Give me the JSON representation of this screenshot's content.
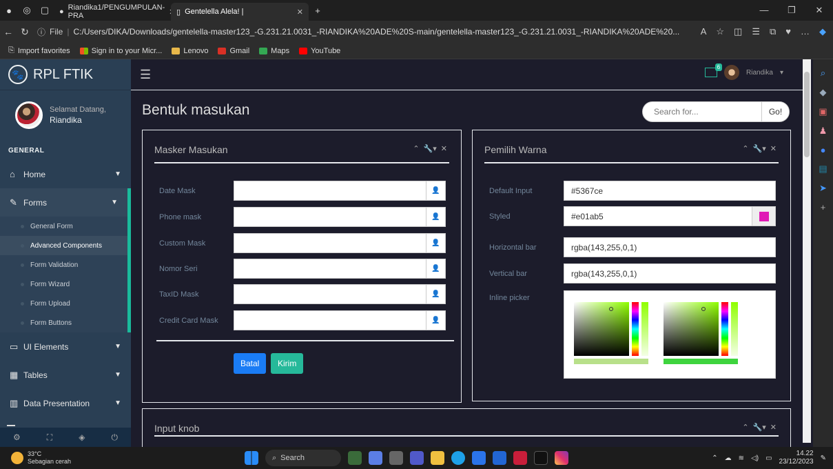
{
  "browser": {
    "tabs": [
      {
        "label": "Riandika1/PENGUMPULAN-PRA",
        "active": false
      },
      {
        "label": "Gentelella Alela! |",
        "active": true
      }
    ],
    "url_prefix": "File",
    "url": "C:/Users/DIKA/Downloads/gentelella-master123_-G.231.21.0031_-RIANDIKA%20ADE%20S-main/gentelella-master123_-G.231.21.0031_-RIANDIKA%20ADE%20...",
    "favorites": [
      "Import favorites",
      "Sign in to your Micr...",
      "Lenovo",
      "Gmail",
      "Maps",
      "YouTube"
    ]
  },
  "sidebar": {
    "brand": "RPL FTIK",
    "welcome": "Selamat Datang,",
    "username": "Riandika",
    "section": "GENERAL",
    "items": [
      {
        "label": "Home"
      },
      {
        "label": "Forms"
      },
      {
        "label": "UI Elements"
      },
      {
        "label": "Tables"
      },
      {
        "label": "Data Presentation"
      }
    ],
    "forms_sub": [
      {
        "label": "General Form"
      },
      {
        "label": "Advanced Components"
      },
      {
        "label": "Form Validation"
      },
      {
        "label": "Form Wizard"
      },
      {
        "label": "Form Upload"
      },
      {
        "label": "Form Buttons"
      }
    ]
  },
  "topnav": {
    "mail_count": "6",
    "user": "Riandika"
  },
  "page": {
    "title": "Bentuk masukan",
    "search_placeholder": "Search for...",
    "search_button": "Go!"
  },
  "mask_panel": {
    "title": "Masker Masukan",
    "fields": [
      {
        "label": "Date Mask"
      },
      {
        "label": "Phone mask"
      },
      {
        "label": "Custom Mask"
      },
      {
        "label": "Nomor Seri"
      },
      {
        "label": "TaxID Mask"
      },
      {
        "label": "Credit Card Mask"
      }
    ],
    "cancel": "Batal",
    "submit": "Kirim"
  },
  "color_panel": {
    "title": "Pemilih Warna",
    "default_label": "Default Input",
    "default_value": "#5367ce",
    "styled_label": "Styled",
    "styled_value": "#e01ab5",
    "styled_color": "#e01ab5",
    "hbar_label": "Horizontal bar",
    "hbar_value": "rgba(143,255,0,1)",
    "vbar_label": "Vertical bar",
    "vbar_value": "rgba(143,255,0,1)",
    "inline_label": "Inline picker"
  },
  "knob_panel": {
    "title": "Input knob"
  },
  "taskbar": {
    "temp": "33°C",
    "weather": "Sebagian cerah",
    "search": "Search",
    "time": "14.22",
    "date": "23/12/2023"
  }
}
